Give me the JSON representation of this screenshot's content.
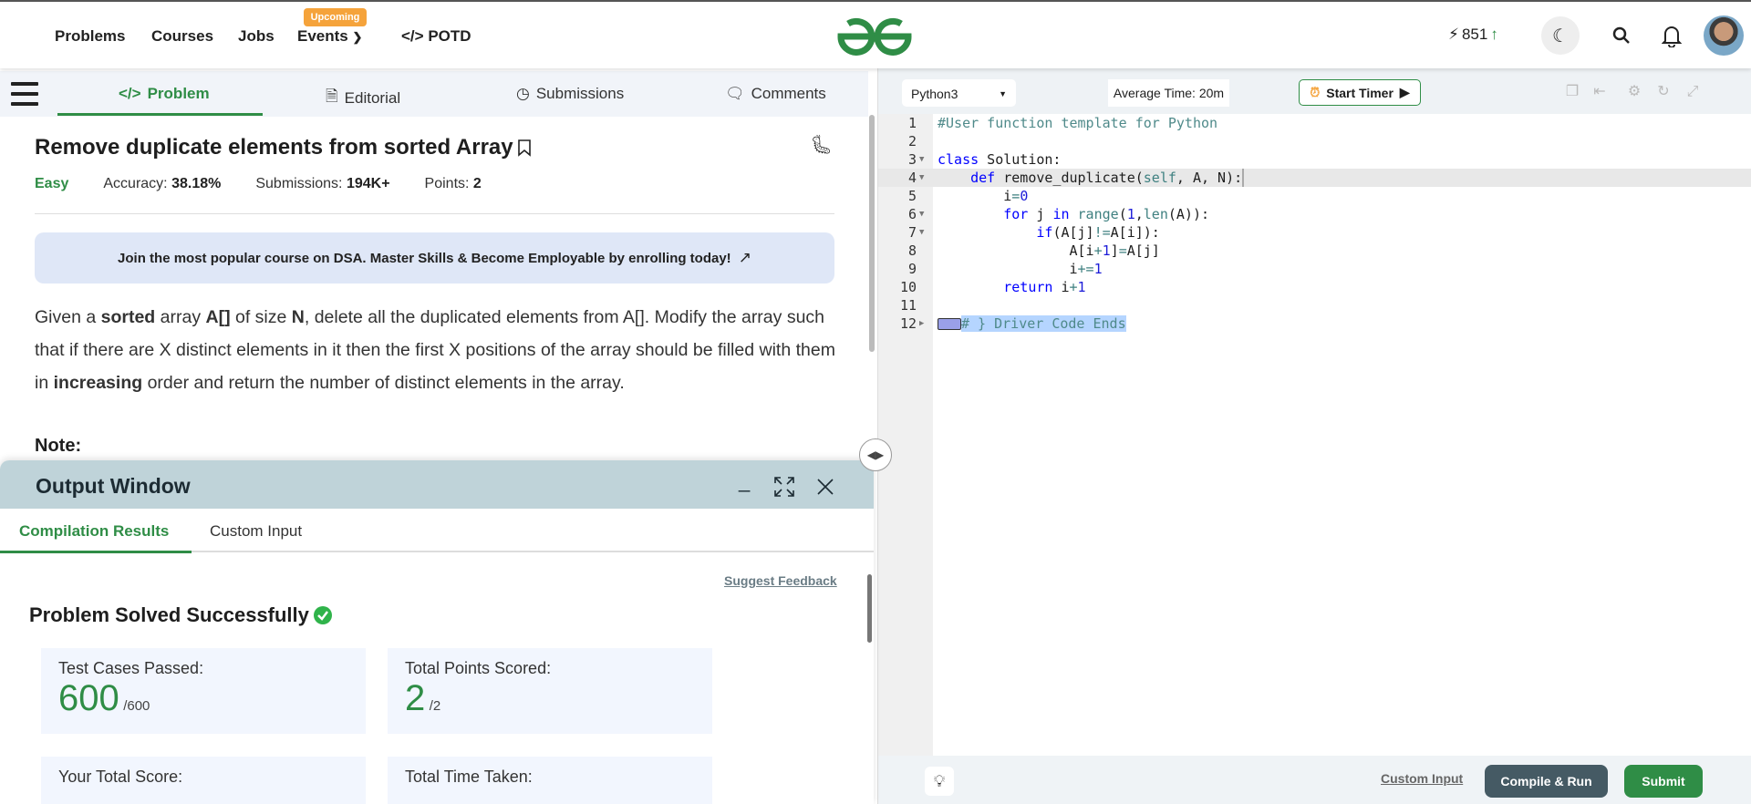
{
  "nav": {
    "items": [
      "Problems",
      "Courses",
      "Jobs",
      "Events",
      "POTD"
    ],
    "events_badge": "Upcoming",
    "streak": "851",
    "brand_color": "#2f8d46"
  },
  "problem_tabs": [
    "Problem",
    "Editorial",
    "Submissions",
    "Comments"
  ],
  "problem": {
    "title": "Remove duplicate elements from sorted Array",
    "difficulty": "Easy",
    "accuracy_label": "Accuracy:",
    "accuracy": "38.18%",
    "submissions_label": "Submissions:",
    "submissions": "194K+",
    "points_label": "Points:",
    "points": "2",
    "banner": "Join the most popular course on DSA. Master Skills & Become Employable by enrolling today!",
    "desc": [
      "Given a ",
      "sorted",
      " array ",
      "A[]",
      " of size ",
      "N",
      ", delete all the duplicated elements from A[]. Modify the array such that if there are X distinct elements in it then the first X positions of the array should be filled with them in ",
      "increasing",
      " order and return the number of distinct elements in the array."
    ],
    "note": "Note:"
  },
  "output": {
    "title": "Output Window",
    "tabs": [
      "Compilation Results",
      "Custom Input"
    ],
    "feedback": "Suggest Feedback",
    "status": "Problem Solved Successfully",
    "cards": [
      {
        "label": "Test Cases Passed:",
        "value": "600",
        "total": "/600"
      },
      {
        "label": "Total Points Scored:",
        "value": "2",
        "total": "/2"
      },
      {
        "label": "Your Total Score:"
      },
      {
        "label": "Total Time Taken:"
      }
    ]
  },
  "editor": {
    "language": "Python3",
    "avg_time": "Average Time: 20m",
    "timer": "Start Timer",
    "code": [
      [
        [
          "#User function template for Python",
          "c"
        ]
      ],
      [],
      [
        [
          "class",
          "k"
        ],
        [
          " Solution:",
          ""
        ]
      ],
      [
        [
          "    ",
          ""
        ],
        [
          "def",
          "k"
        ],
        [
          " remove_duplicate(",
          ""
        ],
        [
          "self",
          "s"
        ],
        [
          ", A, N):",
          ""
        ]
      ],
      [
        [
          "        i",
          ""
        ],
        [
          "=",
          "s"
        ],
        [
          "0",
          "n"
        ]
      ],
      [
        [
          "        ",
          ""
        ],
        [
          "for",
          "k"
        ],
        [
          " j ",
          ""
        ],
        [
          "in",
          "k"
        ],
        [
          " ",
          ""
        ],
        [
          "range",
          "s"
        ],
        [
          "(",
          ""
        ],
        [
          "1",
          "n"
        ],
        [
          ",",
          ""
        ],
        [
          "len",
          "s"
        ],
        [
          "(A)):",
          ""
        ]
      ],
      [
        [
          "            ",
          ""
        ],
        [
          "if",
          "k"
        ],
        [
          "(A[j]",
          ""
        ],
        [
          "!=",
          "s"
        ],
        [
          "A[i]):",
          ""
        ]
      ],
      [
        [
          "                A[i",
          ""
        ],
        [
          "+",
          "s"
        ],
        [
          "1",
          "n"
        ],
        [
          "]",
          ""
        ],
        [
          "=",
          "s"
        ],
        [
          "A[j]",
          ""
        ]
      ],
      [
        [
          "                i",
          ""
        ],
        [
          "+=",
          "s"
        ],
        [
          "1",
          "n"
        ]
      ],
      [
        [
          "        ",
          ""
        ],
        [
          "return",
          "k"
        ],
        [
          " i",
          ""
        ],
        [
          "+",
          "s"
        ],
        [
          "1",
          "n"
        ]
      ],
      [],
      [
        [
          "# } Driver Code Ends",
          "c sel"
        ]
      ]
    ],
    "folds": [
      3,
      4,
      6,
      7
    ],
    "collapsed": [
      12
    ],
    "active_line": 4,
    "custom_input": "Custom Input",
    "compile": "Compile & Run",
    "submit": "Submit"
  }
}
